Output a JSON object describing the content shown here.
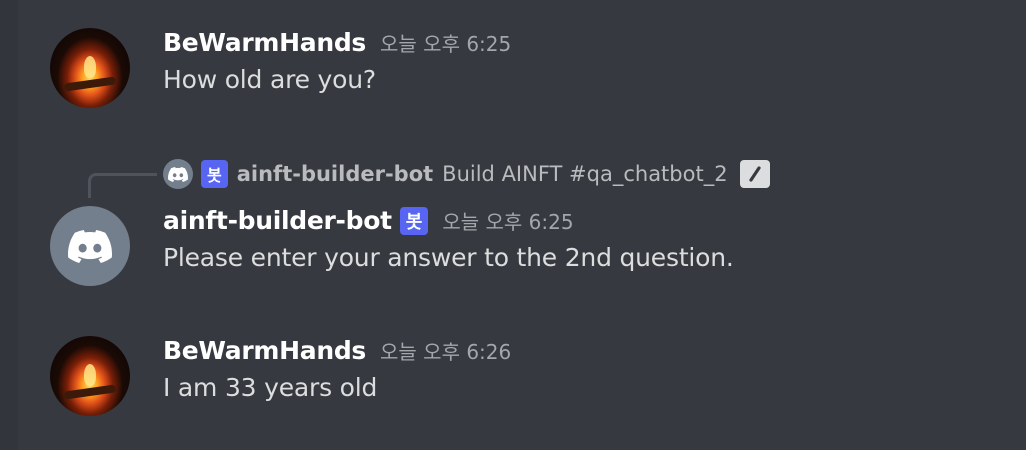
{
  "messages": [
    {
      "username": "BeWarmHands",
      "timestamp": "오늘 오후 6:25",
      "text": "How old are you?",
      "avatar_icon": "fireplace-avatar"
    },
    {
      "username": "ainft-builder-bot",
      "bot_tag": "봇",
      "timestamp": "오늘 오후 6:25",
      "text": "Please enter your answer to the 2nd question.",
      "avatar_icon": "discord-logo-icon",
      "reply": {
        "bot_tag": "봇",
        "username": "ainft-builder-bot",
        "text": "Build AINFT #qa_chatbot_2",
        "command_icon": "slash-command-icon"
      }
    },
    {
      "username": "BeWarmHands",
      "timestamp": "오늘 오후 6:26",
      "text": "I am 33 years old",
      "avatar_icon": "fireplace-avatar"
    }
  ],
  "colors": {
    "background": "#36393f",
    "bot_tag": "#5865f2",
    "username": "#ffffff",
    "text": "#dcddde",
    "timestamp": "#a3a6aa"
  }
}
